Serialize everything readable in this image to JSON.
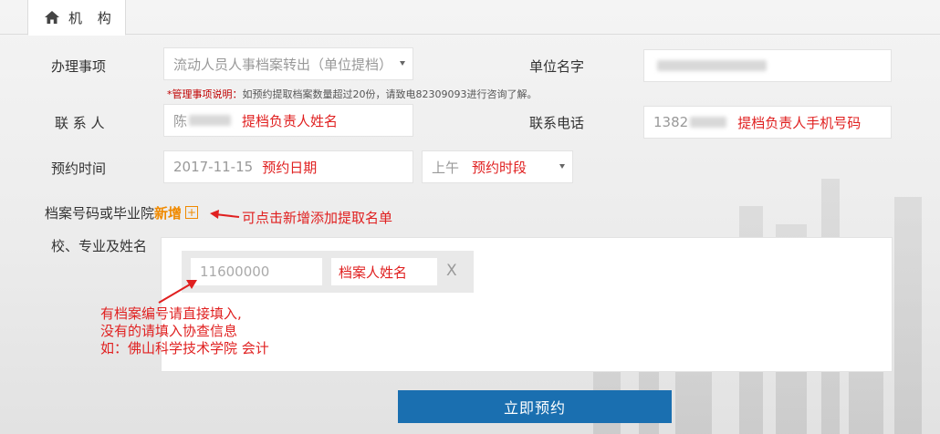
{
  "tab": {
    "label": "机 构",
    "icon": "home-icon"
  },
  "form": {
    "matter_label": "办理事项",
    "matter_value": "流动人员人事档案转出（单位提档）",
    "unit_label": "单位名字",
    "note_prefix": "*管理事项说明：",
    "note_text": "如预约提取档案数量超过20份，请致电82309093进行咨询了解。",
    "contact_label": "联 系 人",
    "contact_prefix": "陈",
    "contact_hint": "提档负责人姓名",
    "phone_label": "联系电话",
    "phone_prefix": "1382",
    "phone_hint": "提档负责人手机号码",
    "time_label": "预约时间",
    "date_value": "2017-11-15",
    "date_hint": "预约日期",
    "period_value": "上午",
    "period_hint": "预约时段",
    "archive_label_1": "档案号码或毕业院",
    "archive_add": "新增",
    "archive_add_icon": "+",
    "archive_label_2": "校、专业及姓名",
    "add_annotation": "可点击新增添加提取名单",
    "entry_number": "11600000",
    "entry_name": "档案人姓名",
    "entry_remove": "X",
    "instructions": [
      "有档案编号请直接填入,",
      "没有的请填入协查信息",
      "如：佛山科学技术学院 会计"
    ],
    "submit_label": "立即预约"
  },
  "colors": {
    "accent": "#1a6fb0",
    "annotation": "#e02020",
    "add": "#f08a00"
  }
}
